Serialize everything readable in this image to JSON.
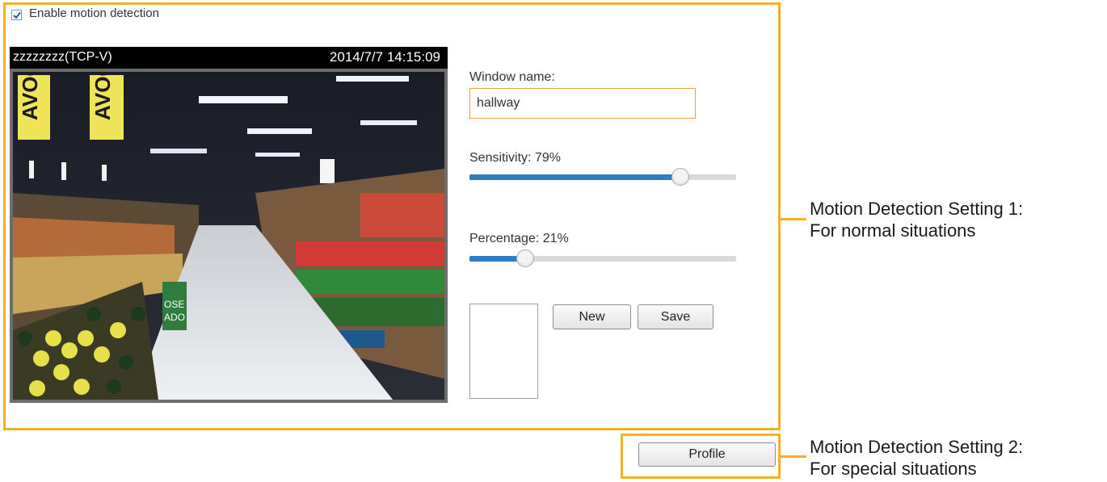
{
  "motion": {
    "enable_label": "Enable motion detection",
    "enable_checked": true
  },
  "video": {
    "name": "zzzzzzzz(TCP-V)",
    "timestamp": "2014/7/7 14:15:09"
  },
  "window": {
    "name_label": "Window name:",
    "name_value": "hallway",
    "sensitivity_label": "Sensitivity: 79%",
    "sensitivity_value": 79,
    "percentage_label": "Percentage: 21%",
    "percentage_value": 21
  },
  "buttons": {
    "new_label": "New",
    "save_label": "Save",
    "profile_label": "Profile"
  },
  "callouts": {
    "setting1_line1": "Motion Detection Setting 1:",
    "setting1_line2": "For normal situations",
    "setting2_line1": "Motion Detection Setting 2:",
    "setting2_line2": "For special situations"
  },
  "colors": {
    "highlight": "#f5b21e",
    "slider_fill": "#2d7fc1",
    "input_border": "#f0a040"
  },
  "icons": {
    "checkbox": "checkmark-icon"
  }
}
